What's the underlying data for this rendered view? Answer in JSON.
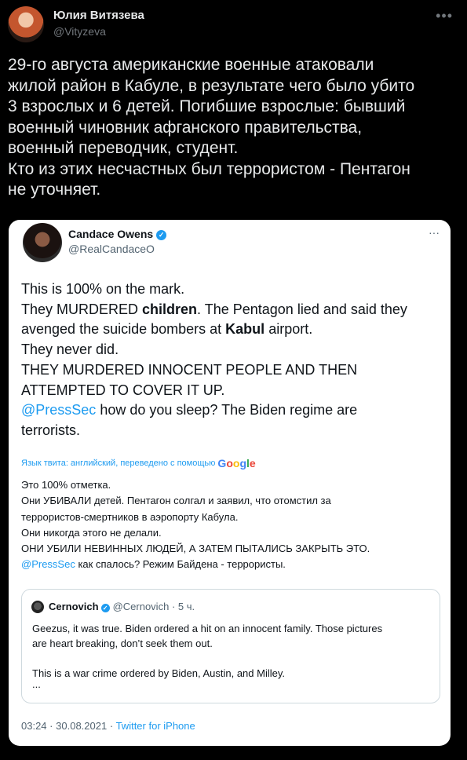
{
  "author": {
    "name": "Юлия Витязева",
    "handle": "@Vityzeva",
    "more_icon": "ellipsis-icon"
  },
  "tweet_lines": [
    "29-го августа американские военные атаковали",
    "жилой район в Кабуле, в результате чего было убито",
    "3 взрослых и 6 детей. Погибшие взрослые: бывший",
    "военный чиновник афганского правительства,",
    "военный переводчик, студент.",
    "Кто из этих несчастных был террористом - Пентагон",
    "не уточняет."
  ],
  "embedded": {
    "name": "Candace Owens",
    "handle": "@RealCandaceO",
    "verified_mark": "✓",
    "more": "···",
    "en": {
      "l1": "This is 100% on the mark.",
      "l2a": "They MURDERED ",
      "l2b": "children",
      "l2c": ". The Pentagon lied and said they",
      "l3a": "avenged the suicide bombers at ",
      "l3b": "Kabul",
      "l3c": " airport.",
      "l4": "They never did.",
      "l5": "THEY MURDERED INNOCENT PEOPLE AND THEN",
      "l6": "ATTEMPTED TO COVER IT UP.",
      "l7_link": "@PressSec",
      "l7_rest": " how do you sleep? The Biden regime are",
      "l8": "terrorists."
    },
    "translation_label": "Язык твита: английский, переведено с помощью",
    "google": [
      "G",
      "o",
      "o",
      "g",
      "l",
      "e"
    ],
    "ru": {
      "l1": "Это 100% отметка.",
      "l2": "Они УБИВАЛИ детей. Пентагон солгал и заявил, что отомстил за",
      "l3": "террористов-смертников в аэропорту Кабула.",
      "l4": "Они никогда этого не делали.",
      "l5": "ОНИ УБИЛИ НЕВИННЫХ ЛЮДЕЙ, А ЗАТЕМ ПЫТАЛИСЬ ЗАКРЫТЬ ЭТО.",
      "l6_link": "@PressSec",
      "l6_rest": " как спалось? Режим Байдена - террористы."
    },
    "quote": {
      "name": "Cernovich",
      "handle": "@Cernovich",
      "sep": "·",
      "time": "5 ч.",
      "l1": "Geezus, it was true. Biden ordered a hit on an innocent family. Those pictures",
      "l2": "are heart breaking, don’t seek them out.",
      "l3": "This is a war crime ordered by Biden, Austin, and Milley.",
      "l4": "..."
    },
    "footer": {
      "time": "03:24",
      "sep1": "·",
      "date": "30.08.2021",
      "sep2": "·",
      "source": "Twitter for iPhone"
    }
  },
  "colors": {
    "link": "#1d9bf0",
    "background": "#000000",
    "card": "#ffffff"
  }
}
